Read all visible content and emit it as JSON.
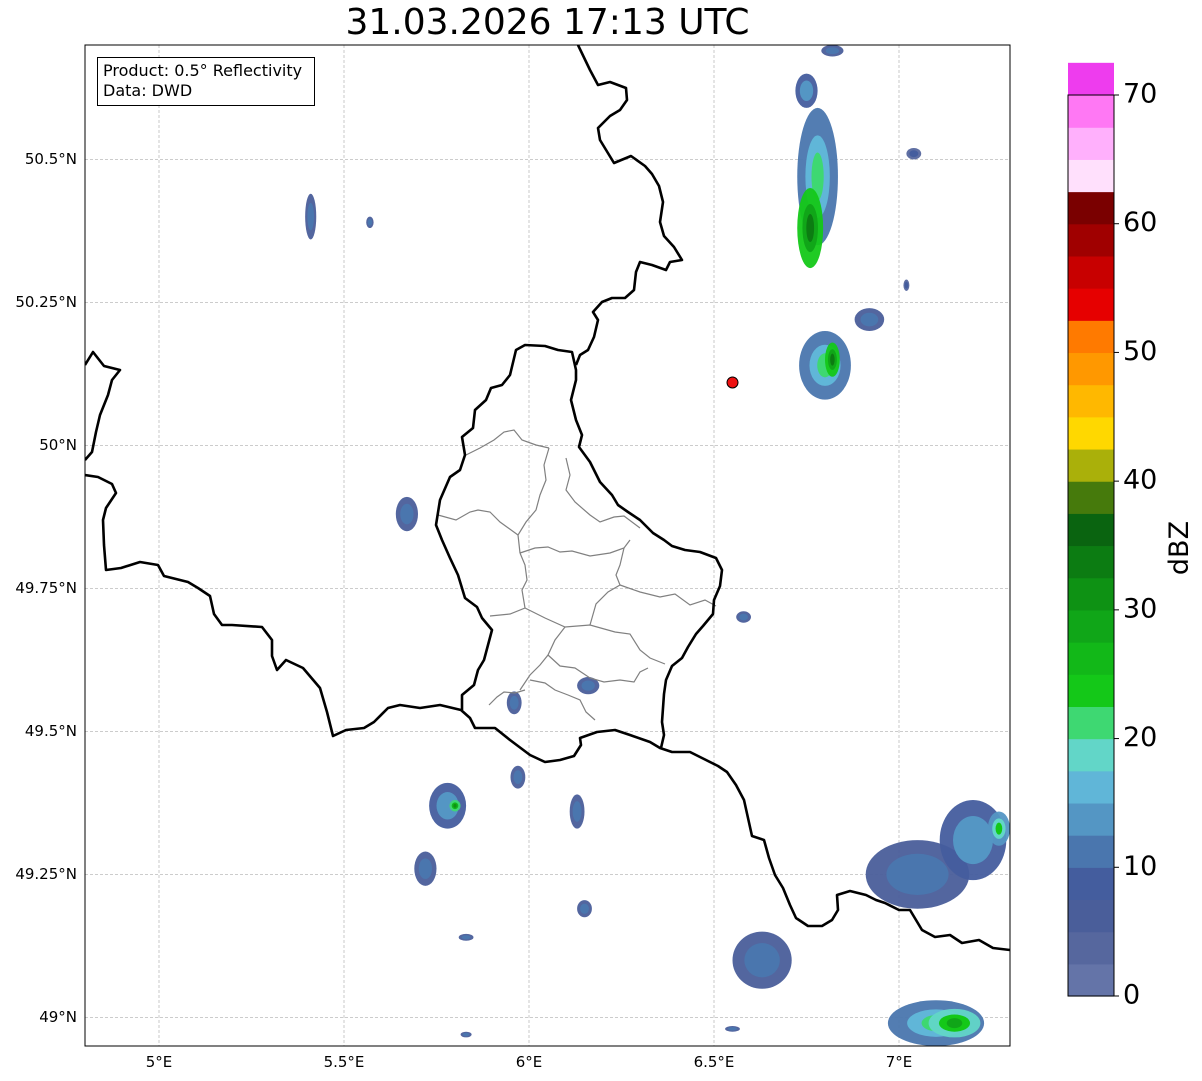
{
  "title": "31.03.2026 17:13 UTC",
  "info": {
    "product": "Product: 0.5° Reflectivity",
    "data": "Data: DWD"
  },
  "map": {
    "lon_range": [
      4.8,
      7.3
    ],
    "lat_range": [
      48.95,
      50.7
    ],
    "lat_ticks": [
      {
        "value": 50.5,
        "label": "50.5°N"
      },
      {
        "value": 50.25,
        "label": "50.25°N"
      },
      {
        "value": 50.0,
        "label": "50°N"
      },
      {
        "value": 49.75,
        "label": "49.75°N"
      },
      {
        "value": 49.5,
        "label": "49.5°N"
      },
      {
        "value": 49.25,
        "label": "49.25°N"
      },
      {
        "value": 49.0,
        "label": "49°N"
      }
    ],
    "lon_ticks": [
      {
        "value": 5.0,
        "label": "5°E"
      },
      {
        "value": 5.5,
        "label": "5.5°E"
      },
      {
        "value": 6.0,
        "label": "6°E"
      },
      {
        "value": 6.5,
        "label": "6.5°E"
      },
      {
        "value": 7.0,
        "label": "7°E"
      }
    ],
    "radar_site": {
      "lon": 6.55,
      "lat": 50.11,
      "color": "#ee1111"
    },
    "gridlines": true
  },
  "colorbar": {
    "label": "dBZ",
    "min": 0,
    "max": 70,
    "step": 2.5,
    "ticks": [
      0,
      10,
      20,
      30,
      40,
      50,
      60,
      70
    ],
    "colors": [
      "#6474a8",
      "#56679e",
      "#4a5e9a",
      "#445d9e",
      "#4a76ae",
      "#5496c4",
      "#60b6d8",
      "#62d6c8",
      "#3ed872",
      "#14c818",
      "#12b818",
      "#10a618",
      "#0e9214",
      "#0c7c12",
      "#0a6410",
      "#467a0c",
      "#aab00a",
      "#ffd800",
      "#ffb800",
      "#ff9800",
      "#ff7a00",
      "#e60000",
      "#c80000",
      "#a00000",
      "#7a0000",
      "#ffe0fc",
      "#ffb0fc",
      "#ff78f4",
      "#ee3cee"
    ]
  },
  "echoes": [
    {
      "lon": 6.78,
      "lat": 50.47,
      "rx": 0.055,
      "ry": 0.12,
      "level": 6
    },
    {
      "lon": 6.76,
      "lat": 50.38,
      "rx": 0.035,
      "ry": 0.07,
      "level": 11
    },
    {
      "lon": 6.8,
      "lat": 50.14,
      "rx": 0.07,
      "ry": 0.06,
      "level": 6
    },
    {
      "lon": 6.82,
      "lat": 50.15,
      "rx": 0.02,
      "ry": 0.03,
      "level": 11
    },
    {
      "lon": 6.92,
      "lat": 50.22,
      "rx": 0.04,
      "ry": 0.02,
      "level": 4
    },
    {
      "lon": 6.75,
      "lat": 50.62,
      "rx": 0.03,
      "ry": 0.03,
      "level": 5
    },
    {
      "lon": 6.82,
      "lat": 50.69,
      "rx": 0.03,
      "ry": 0.01,
      "level": 4
    },
    {
      "lon": 7.04,
      "lat": 50.51,
      "rx": 0.02,
      "ry": 0.01,
      "level": 3
    },
    {
      "lon": 7.02,
      "lat": 50.28,
      "rx": 0.008,
      "ry": 0.01,
      "level": 3
    },
    {
      "lon": 5.41,
      "lat": 50.4,
      "rx": 0.015,
      "ry": 0.04,
      "level": 4
    },
    {
      "lon": 5.57,
      "lat": 50.39,
      "rx": 0.01,
      "ry": 0.01,
      "level": 4
    },
    {
      "lon": 5.67,
      "lat": 49.88,
      "rx": 0.03,
      "ry": 0.03,
      "level": 4
    },
    {
      "lon": 5.78,
      "lat": 49.37,
      "rx": 0.05,
      "ry": 0.04,
      "level": 5
    },
    {
      "lon": 5.8,
      "lat": 49.37,
      "rx": 0.015,
      "ry": 0.01,
      "level": 10
    },
    {
      "lon": 5.72,
      "lat": 49.26,
      "rx": 0.03,
      "ry": 0.03,
      "level": 4
    },
    {
      "lon": 5.96,
      "lat": 49.55,
      "rx": 0.02,
      "ry": 0.02,
      "level": 4
    },
    {
      "lon": 5.97,
      "lat": 49.42,
      "rx": 0.02,
      "ry": 0.02,
      "level": 4
    },
    {
      "lon": 6.13,
      "lat": 49.36,
      "rx": 0.02,
      "ry": 0.03,
      "level": 4
    },
    {
      "lon": 6.16,
      "lat": 49.58,
      "rx": 0.03,
      "ry": 0.015,
      "level": 4
    },
    {
      "lon": 6.58,
      "lat": 49.7,
      "rx": 0.02,
      "ry": 0.01,
      "level": 4
    },
    {
      "lon": 6.15,
      "lat": 49.19,
      "rx": 0.02,
      "ry": 0.015,
      "level": 4
    },
    {
      "lon": 7.05,
      "lat": 49.25,
      "rx": 0.14,
      "ry": 0.06,
      "level": 4
    },
    {
      "lon": 7.2,
      "lat": 49.31,
      "rx": 0.09,
      "ry": 0.07,
      "level": 5
    },
    {
      "lon": 7.27,
      "lat": 49.33,
      "rx": 0.03,
      "ry": 0.03,
      "level": 7
    },
    {
      "lon": 6.63,
      "lat": 49.1,
      "rx": 0.08,
      "ry": 0.05,
      "level": 4
    },
    {
      "lon": 7.1,
      "lat": 48.99,
      "rx": 0.13,
      "ry": 0.04,
      "level": 6
    },
    {
      "lon": 7.15,
      "lat": 48.99,
      "rx": 0.07,
      "ry": 0.025,
      "level": 9
    },
    {
      "lon": 5.83,
      "lat": 49.14,
      "rx": 0.02,
      "ry": 0.006,
      "level": 4
    },
    {
      "lon": 5.83,
      "lat": 48.97,
      "rx": 0.015,
      "ry": 0.005,
      "level": 4
    },
    {
      "lon": 6.55,
      "lat": 48.98,
      "rx": 0.02,
      "ry": 0.005,
      "level": 4
    }
  ]
}
